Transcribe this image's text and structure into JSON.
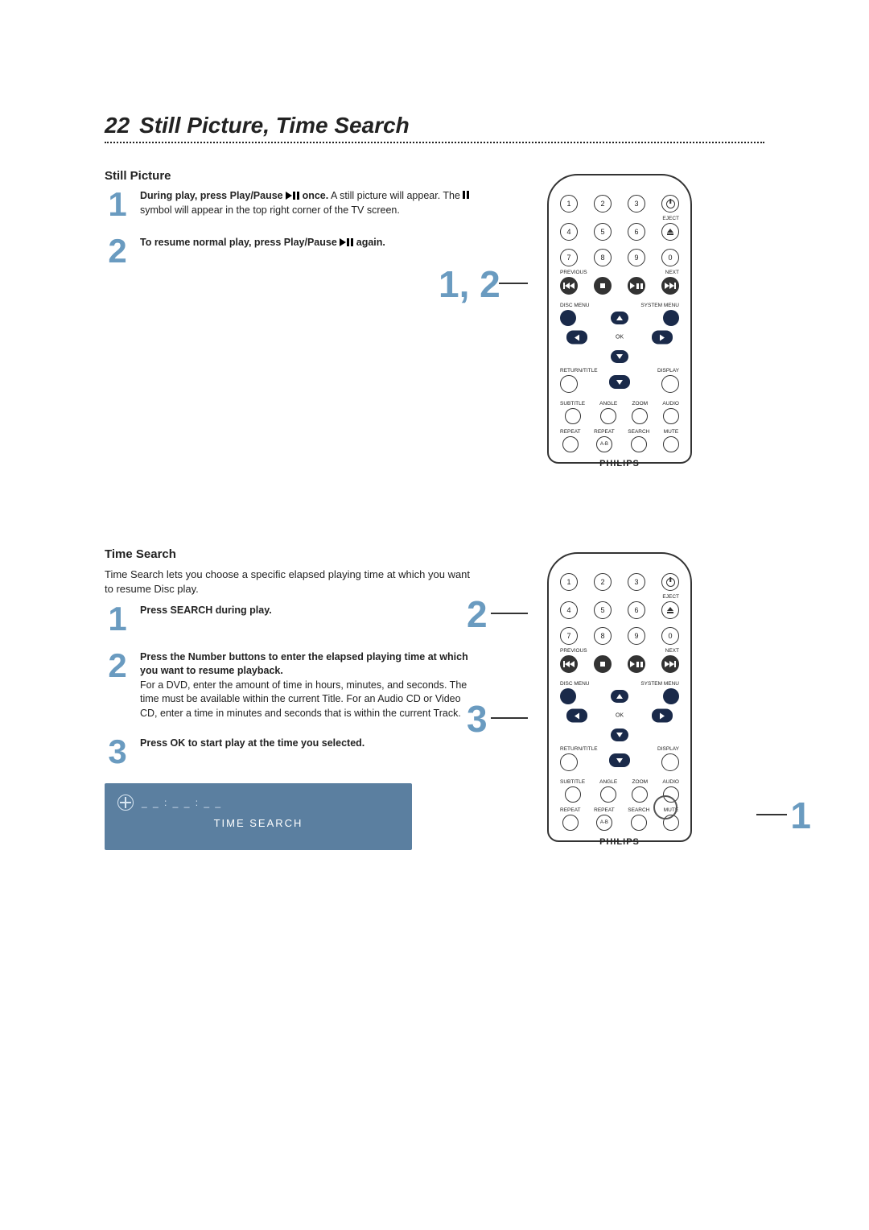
{
  "page_number": "22",
  "page_title": "Still Picture, Time Search",
  "still_picture": {
    "heading": "Still Picture",
    "step1_bold": "During play, press Play/Pause ",
    "step1_bold_tail": " once.",
    "step1_rest": "  A still picture will appear. The ",
    "step1_rest_tail": " symbol will appear in the top right corner of the TV screen.",
    "step2_bold": "To resume normal play, press Play/Pause ",
    "step2_bold_tail": " again.",
    "callout": "1, 2"
  },
  "time_search": {
    "heading": "Time Search",
    "intro": "Time Search lets you choose a specific elapsed playing time at which you want to resume Disc play.",
    "step1": "Press SEARCH during play.",
    "step2_bold": "Press the Number buttons to enter the elapsed playing time at which you want to resume playback.",
    "step2_rest": "For a DVD, enter the amount of time in hours, minutes, and seconds. The time must be available within the current Title. For an Audio CD or Video CD, enter a time in minutes and seconds that is within the current Track.",
    "step3": "Press OK to start play at the time you selected.",
    "callout2": "2",
    "callout3": "3",
    "callout1": "1"
  },
  "osd": {
    "dots": "_ _ : _ _ : _ _",
    "title": "TIME SEARCH"
  },
  "remote": {
    "n1": "1",
    "n2": "2",
    "n3": "3",
    "n4": "4",
    "n5": "5",
    "n6": "6",
    "n7": "7",
    "n8": "8",
    "n9": "9",
    "n0": "0",
    "eject": "EJECT",
    "previous": "PREVIOUS",
    "next": "NEXT",
    "disc_menu": "DISC MENU",
    "system_menu": "SYSTEM MENU",
    "ok": "OK",
    "return_title": "RETURN/TITLE",
    "display": "DISPLAY",
    "subtitle": "SUBTITLE",
    "angle": "ANGLE",
    "zoom": "ZOOM",
    "audio": "AUDIO",
    "repeat": "REPEAT",
    "repeat_ab": "REPEAT",
    "ab": "A-B",
    "search": "SEARCH",
    "mute": "MUTE",
    "brand": "PHILIPS"
  }
}
